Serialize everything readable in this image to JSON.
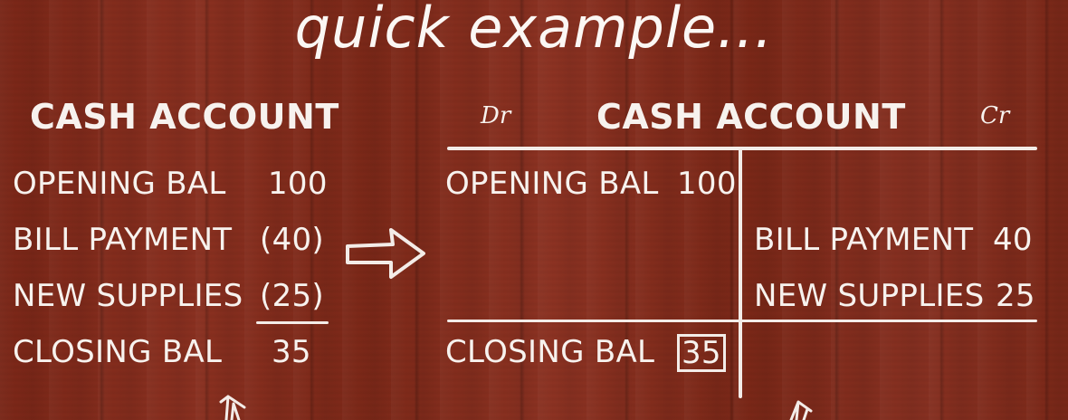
{
  "title": "quick example...",
  "left_account": {
    "heading": "CASH ACCOUNT",
    "rows": [
      {
        "label": "OPENING BAL",
        "amount": "100"
      },
      {
        "label": "BILL PAYMENT",
        "amount": "(40)"
      },
      {
        "label": "NEW SUPPLIES",
        "amount": "(25)"
      },
      {
        "label": "CLOSING BAL",
        "amount": "35"
      }
    ]
  },
  "t_account": {
    "debit_label": "Dr",
    "credit_label": "Cr",
    "heading": "CASH ACCOUNT",
    "debit_rows": [
      {
        "label": "OPENING BAL",
        "amount": "100"
      }
    ],
    "credit_rows": [
      {
        "label": "BILL PAYMENT",
        "amount": "40"
      },
      {
        "label": "NEW SUPPLIES",
        "amount": "25"
      }
    ],
    "closing": {
      "label": "CLOSING BAL",
      "amount": "35"
    }
  },
  "icons": [
    "right-arrow-icon",
    "up-arrow-icon"
  ],
  "colors": {
    "background": "#7f2a1a",
    "chalk": "#f7f2ee"
  }
}
